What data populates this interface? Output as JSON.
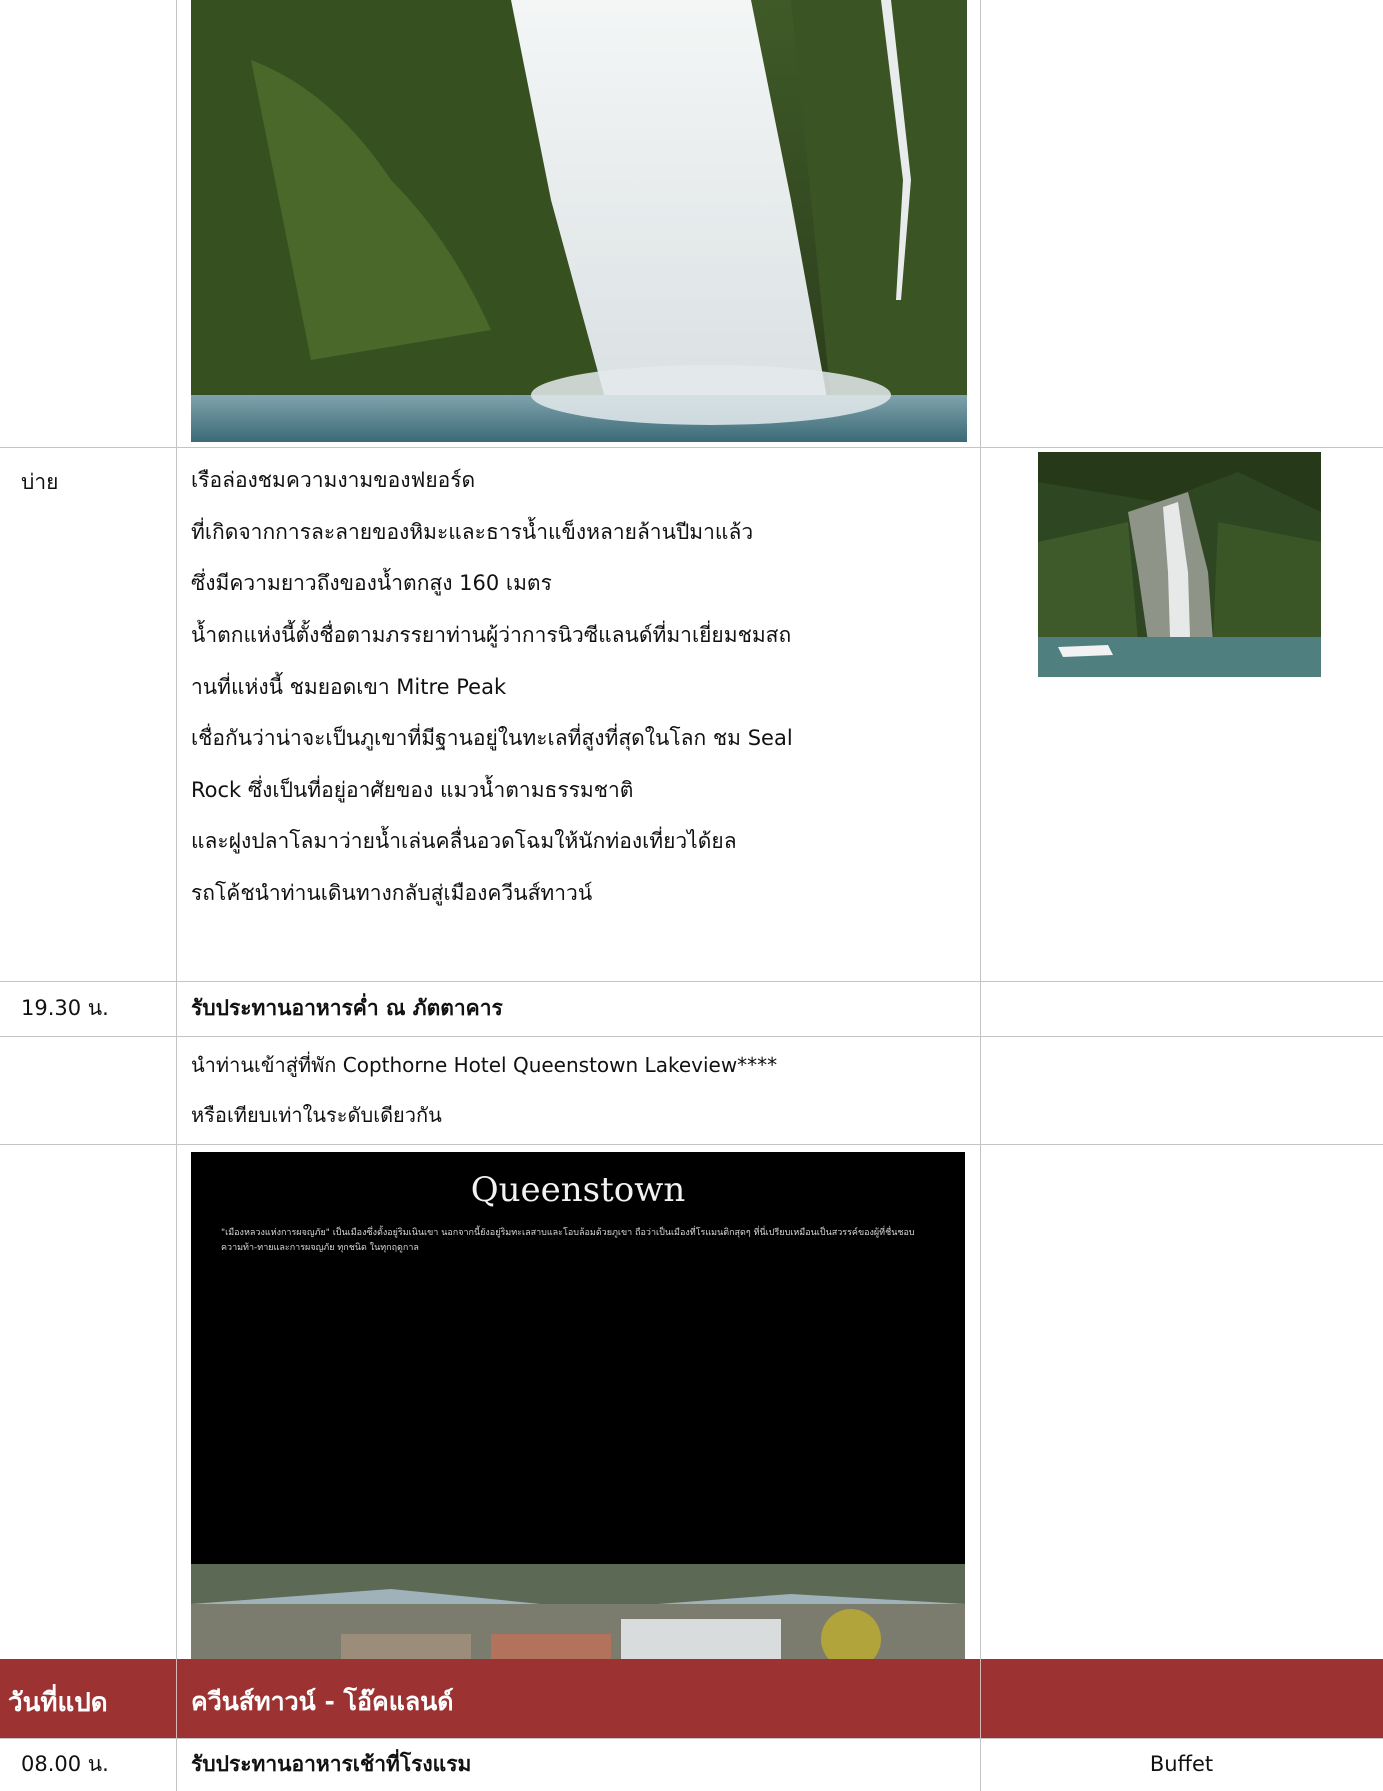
{
  "rows": {
    "afternoon": {
      "time": "บ่าย",
      "lines": [
        "เรือล่องชมความงามของฟยอร์ด",
        "ที่เกิดจากการละลายของหิมะและธารน้ำแข็งหลายล้านปีมาแล้ว",
        "ซึ่งมีความยาวถึงของน้ำตกสูง 160 เมตร",
        "น้ำตกแห่งนี้ตั้งชื่อตามภรรยาท่านผู้ว่าการนิวซีแลนด์ที่มาเยี่ยมชมสถ",
        "านที่แห่งนี้ ชมยอดเขา Mitre Peak",
        "เชื่อกันว่าน่าจะเป็นภูเขาที่มีฐานอยู่ในทะเลที่สูงที่สุดในโลก ชม Seal",
        "Rock ซึ่งเป็นที่อยู่อาศัยของ แมวน้ำตามธรรมชาติ",
        "และฝูงปลาโลมาว่ายน้ำเล่นคลื่นอวดโฉมให้นักท่องเที่ยวได้ยล",
        "รถโค้ชนำท่านเดินทางกลับสู่เมืองควีนส์ทาวน์"
      ]
    },
    "dinner": {
      "time": "19.30 น.",
      "text": "รับประทานอาหารค่ำ ณ ภัตตาคาร"
    },
    "hotel": {
      "lines": [
        "นำท่านเข้าสู่ที่พัก Copthorne Hotel Queenstown Lakeview****",
        "หรือเทียบเท่าในระดับเดียวกัน"
      ]
    },
    "queenstown_banner": {
      "title": "Queenstown",
      "text": "\"เมืองหลวงแห่งการผจญภัย\" เป็นเมืองซึ่งตั้งอยู่ริมเนินเขา นอกจากนี้ยังอยู่ริมทะเลสาบและโอบล้อมด้วยภูเขา ถือว่าเป็นเมืองที่โรแมนติกสุดๆ ที่นี่เปรียบเหมือนเป็นสวรรค์ของผู้ที่ชื่นชอบความท้า-ทายและการผจญภัย ทุกชนิด ในทุกฤดูกาล"
    },
    "day8": {
      "day": "วันที่แปด",
      "title": "ควีนส์ทาวน์ - โอ๊คแลนด์"
    },
    "breakfast": {
      "time": "08.00 น.",
      "text": "รับประทานอาหารเช้าที่โรงแรม",
      "meal": "Buffet"
    }
  }
}
